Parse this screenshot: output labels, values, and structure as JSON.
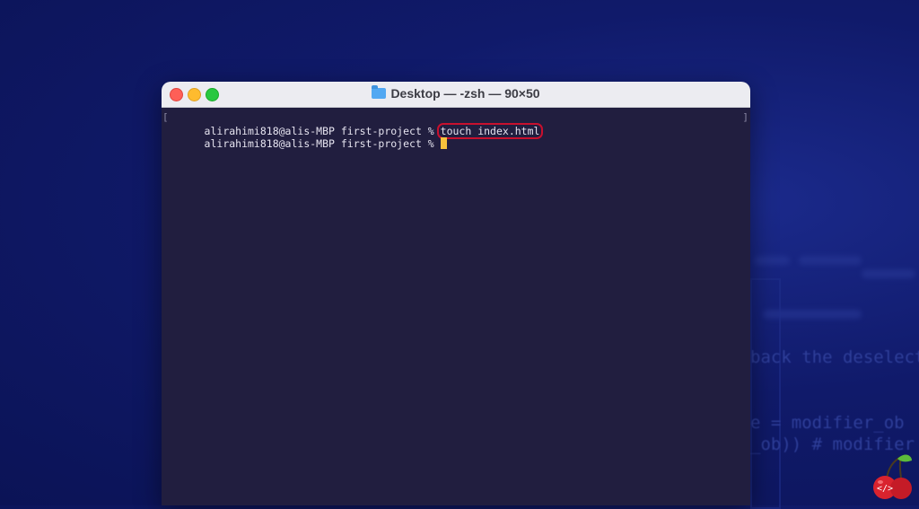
{
  "window": {
    "title": "Desktop — -zsh — 90×50",
    "title_icon": "folder-icon"
  },
  "terminal": {
    "lines": [
      {
        "prompt": "alirahimi818@alis-MBP first-project % ",
        "command": "touch index.html"
      },
      {
        "prompt": "alirahimi818@alis-MBP first-project % ",
        "command": ""
      }
    ],
    "left_marker": "[",
    "right_marker": "]"
  },
  "background_code": {
    "line1": "back the deselecte",
    "line2": "e = modifier_ob",
    "line3": "_ob)) # modifier o"
  },
  "colors": {
    "background": "#101a6a",
    "terminal_bg": "#211e3f",
    "cursor": "#f7c23c",
    "highlight": "#c8102e"
  }
}
